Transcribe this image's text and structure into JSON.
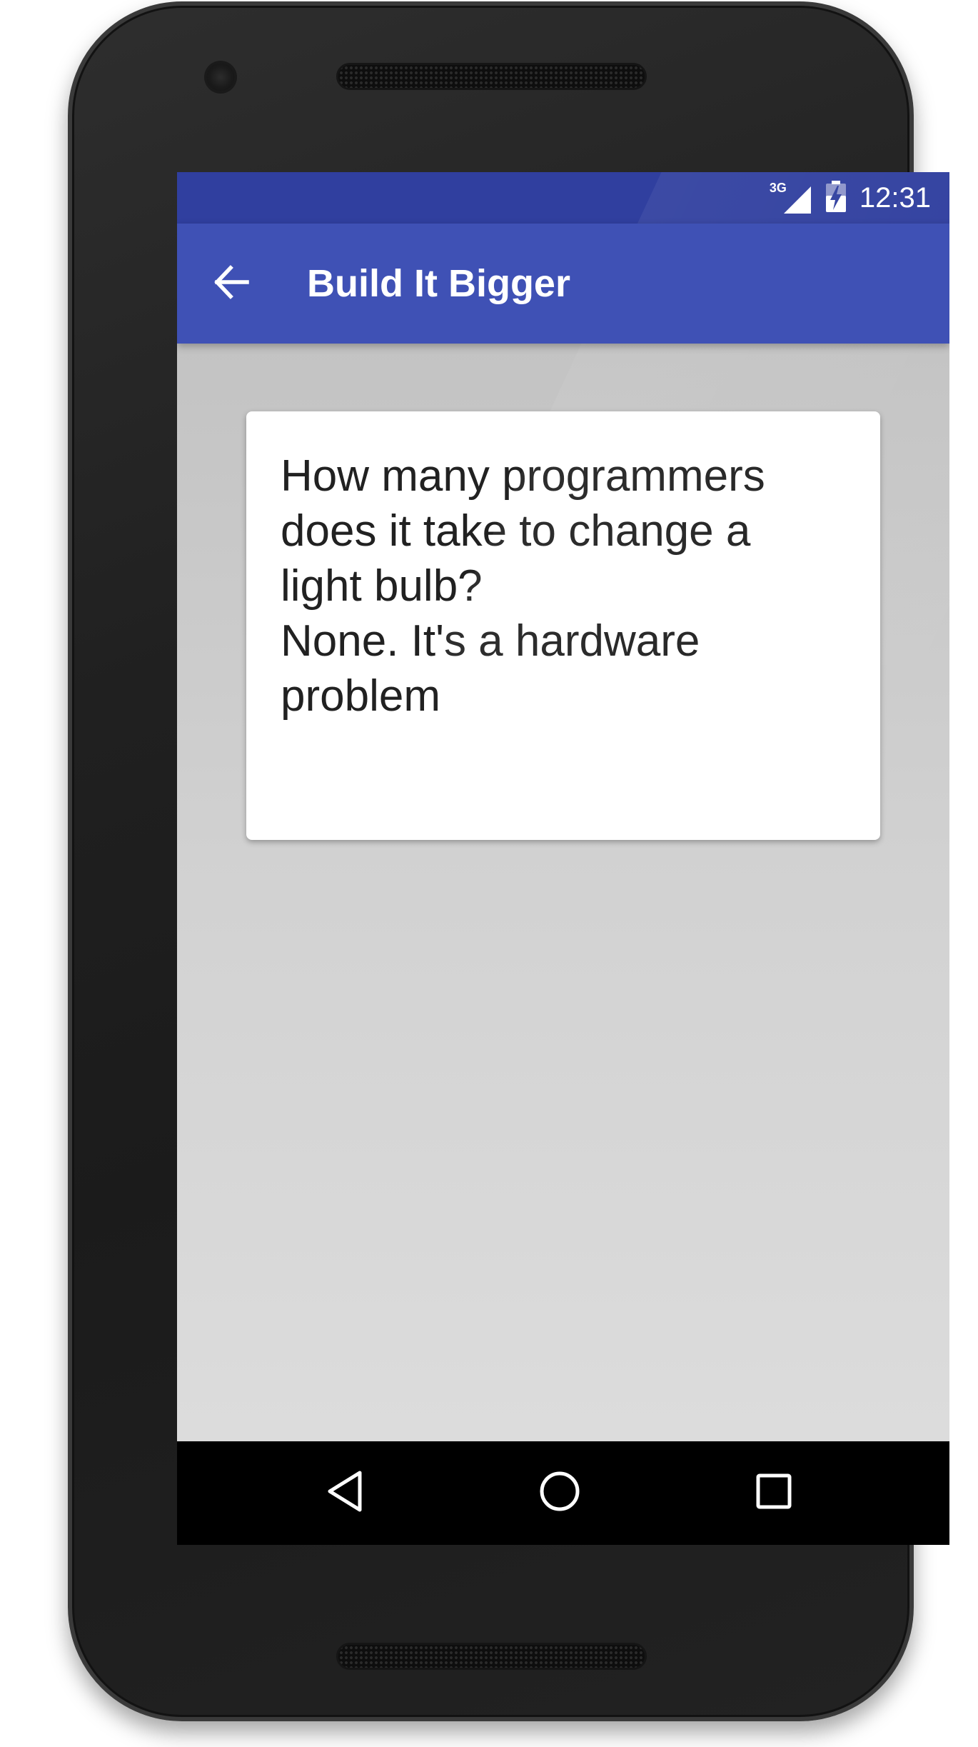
{
  "status_bar": {
    "network_label": "3G",
    "network_icon": "signal-icon",
    "battery_icon": "battery-charging-icon",
    "time": "12:31"
  },
  "toolbar": {
    "back_icon": "arrow-back-icon",
    "title": "Build It Bigger"
  },
  "card": {
    "joke_text": "How many programmers\ndoes it take to change a\nlight bulb?\nNone. It's a hardware\nproblem"
  },
  "nav_bar": {
    "back_icon": "nav-back-triangle-icon",
    "home_icon": "nav-home-circle-icon",
    "recents_icon": "nav-recents-square-icon"
  },
  "colors": {
    "status_bar": "#303f9f",
    "toolbar": "#3f51b5",
    "content_background": "#cfcfcf",
    "card": "#ffffff",
    "text": "#212121",
    "nav_bar": "#000000"
  }
}
